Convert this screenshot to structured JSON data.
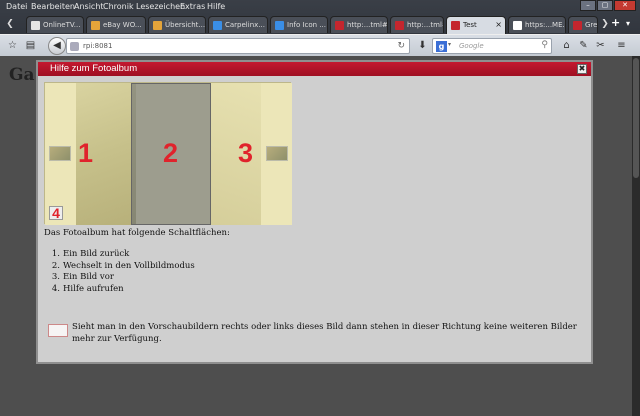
{
  "menu": [
    "Datei",
    "Bearbeiten",
    "Ansicht",
    "Chronik",
    "Lesezeichen",
    "Extras",
    "Hilfe"
  ],
  "window_buttons": [
    "–",
    "▢",
    "✕"
  ],
  "tabs": [
    {
      "label": "OnlineTV...",
      "color": "#e5e5e5"
    },
    {
      "label": "eBay WO...",
      "color": "#e4a43a"
    },
    {
      "label": "Übersicht...",
      "color": "#e4a43a"
    },
    {
      "label": "Carpelinx...",
      "color": "#3a8ee6"
    },
    {
      "label": "Info Icon ...",
      "color": "#3a8ee6"
    },
    {
      "label": "http:...tml#",
      "color": "#c4262e"
    },
    {
      "label": "http:...tml#",
      "color": "#c4262e"
    },
    {
      "label": "Test",
      "color": "#c4262e"
    },
    {
      "label": "https:...ME.md",
      "color": "#ffffff"
    },
    {
      "label": "Gre...",
      "color": "#c4262e"
    }
  ],
  "nav": {
    "url": "rpi:8081",
    "search_placeholder": "Google"
  },
  "page": {
    "title_fragment": "Ga"
  },
  "dialog": {
    "title": "Hilfe zum Fotoalbum",
    "close_label": "✖",
    "numbers": [
      "1",
      "2",
      "3",
      "4"
    ],
    "intro": "Das Fotoalbum hat folgende Schaltflächen:",
    "items": [
      {
        "n": "1.",
        "text": "Ein Bild zurück"
      },
      {
        "n": "2.",
        "text": "Wechselt in den Vollbildmodus"
      },
      {
        "n": "3.",
        "text": "Ein Bild vor"
      },
      {
        "n": "4.",
        "text": "Hilfe aufrufen"
      }
    ],
    "note": "Sieht man in den Vorschaubildern rechts oder links dieses Bild dann stehen in dieser Richtung keine weiteren Bilder mehr zur Verfügung."
  },
  "colors": {
    "dialog_title_bg": "#b0142a",
    "number_red": "#e0232c"
  }
}
